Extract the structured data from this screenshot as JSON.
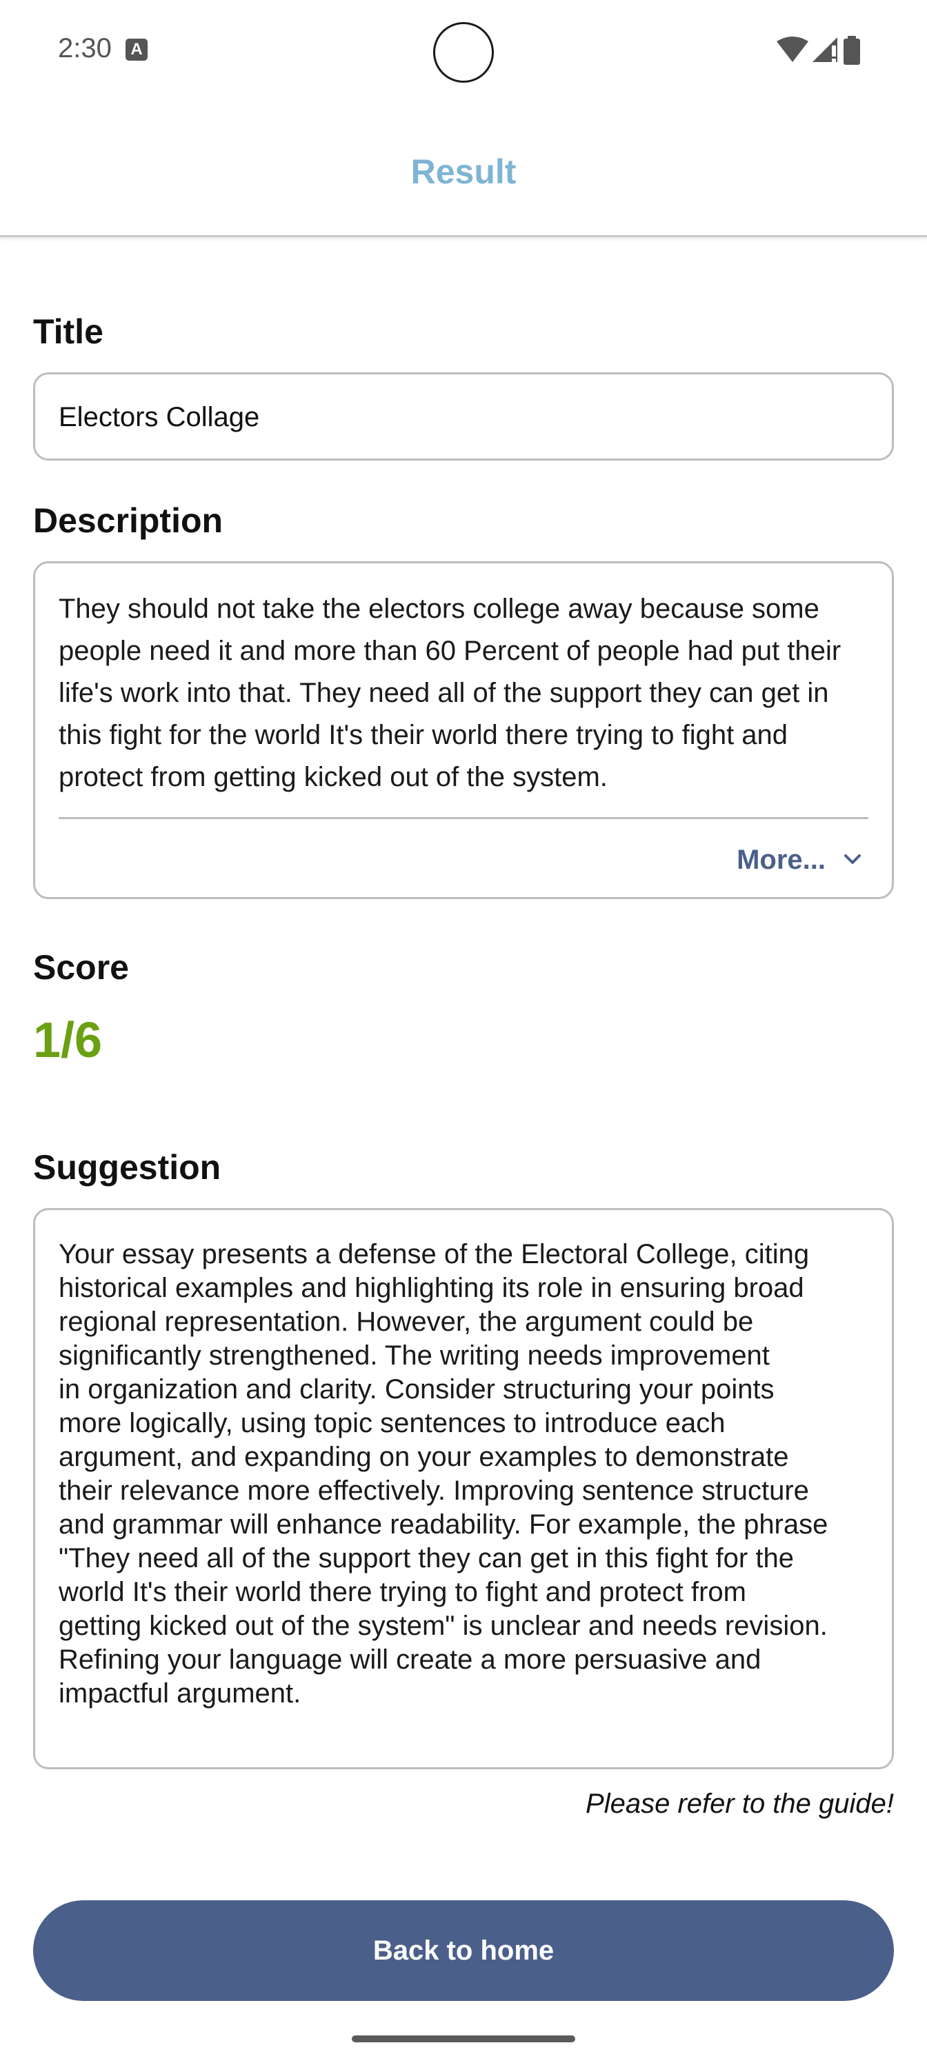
{
  "status_bar": {
    "time": "2:30",
    "notification_icon": "text-a-icon",
    "icons": [
      "wifi-icon",
      "signal-icon",
      "battery-icon"
    ]
  },
  "app_bar": {
    "title": "Result"
  },
  "title_section": {
    "label": "Title",
    "value": "Electors Collage"
  },
  "description_section": {
    "label": "Description",
    "text": "They should not take the electors college away because some people need it and more than 60 Percent of people had put their life's work into that. They need all of the support they can get in this fight for the world It's their world there trying to fight and protect from getting kicked out of the system.",
    "more_label": "More..."
  },
  "score_section": {
    "label": "Score",
    "value": "1/6"
  },
  "suggestion_section": {
    "label": "Suggestion",
    "text": "Your essay presents a defense of the Electoral College, citing\nhistorical examples and highlighting its role in ensuring broad\nregional representation.  However, the argument could be\nsignificantly strengthened.  The writing needs improvement\nin organization and clarity.  Consider structuring your points\nmore logically, using topic sentences to introduce each\nargument, and expanding on your examples to demonstrate\ntheir relevance more effectively.  Improving sentence structure\nand grammar will enhance readability.  For example, the phrase\n\"They need all of the support they can get in this fight for the\nworld It's their world there trying to fight and protect from\ngetting kicked out of the system\" is unclear and needs revision.\nRefining your language will create a more persuasive and\nimpactful argument.",
    "note": "Please refer to the guide!"
  },
  "actions": {
    "home_button_label": "Back to home"
  },
  "colors": {
    "app_title": "#7fb4d4",
    "score": "#6aa012",
    "primary_button": "#4a5f8a",
    "more_link": "#4a6089"
  }
}
